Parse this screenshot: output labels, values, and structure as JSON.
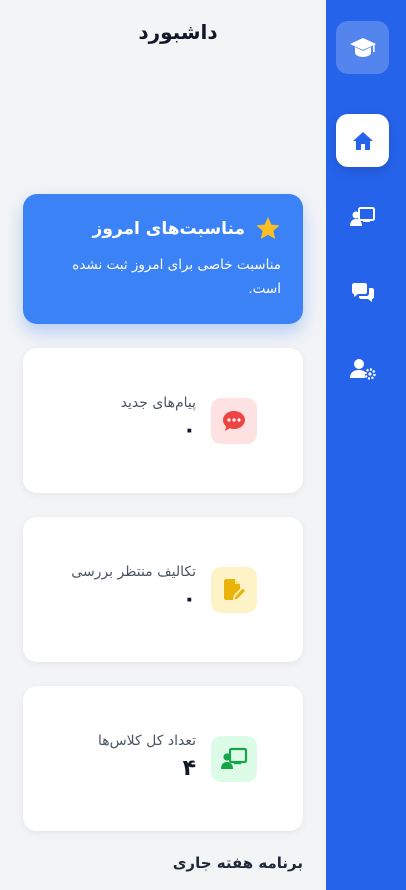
{
  "header": {
    "title": "داشبورد"
  },
  "sidebar": {
    "logo_icon": "graduation-cap-icon",
    "items": [
      {
        "name": "home",
        "icon": "home-icon",
        "active": true
      },
      {
        "name": "classes",
        "icon": "chalkboard-teacher-icon",
        "active": false
      },
      {
        "name": "messages",
        "icon": "comments-icon",
        "active": false
      },
      {
        "name": "settings",
        "icon": "user-cog-icon",
        "active": false
      }
    ]
  },
  "occasion": {
    "icon": "star-icon",
    "title": "مناسبت‌های امروز",
    "text": "مناسبت خاصی برای امروز ثبت نشده است."
  },
  "stats": [
    {
      "label": "پیام‌های جدید",
      "value": "۰",
      "icon": "comment-dots-icon",
      "color": "#ef4444",
      "bg": "#fee2e2"
    },
    {
      "label": "تکالیف منتظر بررسی",
      "value": "۰",
      "icon": "file-edit-icon",
      "color": "#eab308",
      "bg": "#fef3c7"
    },
    {
      "label": "تعداد کل کلاس‌ها",
      "value": "۴",
      "icon": "chalkboard-user-icon",
      "color": "#16a34a",
      "bg": "#dcfce7"
    }
  ],
  "schedule": {
    "title": "برنامه هفته جاری"
  },
  "colors": {
    "primary": "#2563eb",
    "card": "#3b82f6",
    "background": "#f3f4f6"
  }
}
